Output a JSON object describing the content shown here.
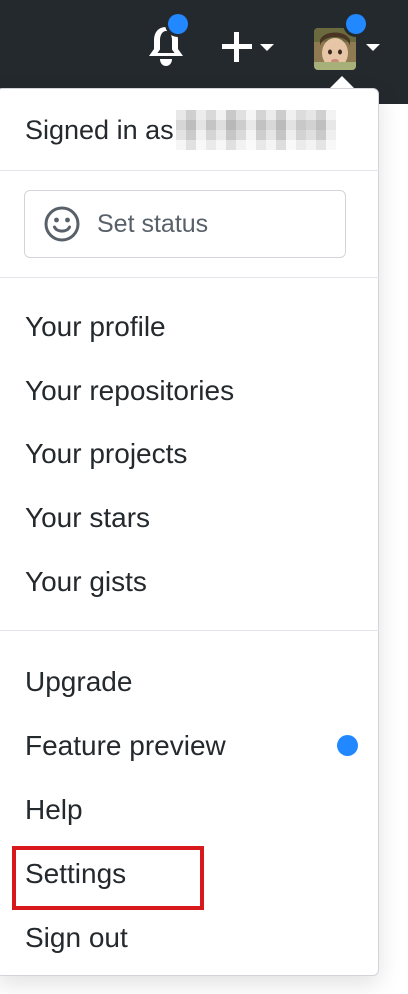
{
  "header": {
    "notification_icon": "bell-icon",
    "create_icon": "plus-icon",
    "create_caret_icon": "caret-down-icon",
    "avatar_caret_icon": "caret-down-icon",
    "background_color": "#24292e",
    "notification_dot_color": "#2188ff"
  },
  "dropdown": {
    "signed_in_prefix": "Signed in as",
    "status": {
      "icon": "smiley-icon",
      "label": "Set status"
    },
    "profile_items": [
      {
        "label": "Your profile"
      },
      {
        "label": "Your repositories"
      },
      {
        "label": "Your projects"
      },
      {
        "label": "Your stars"
      },
      {
        "label": "Your gists"
      }
    ],
    "account_items": [
      {
        "label": "Upgrade"
      },
      {
        "label": "Feature preview"
      },
      {
        "label": "Help"
      },
      {
        "label": "Settings"
      },
      {
        "label": "Sign out"
      }
    ],
    "feature_preview_indicator_color": "#2188ff",
    "highlight_color": "#d7191c"
  }
}
